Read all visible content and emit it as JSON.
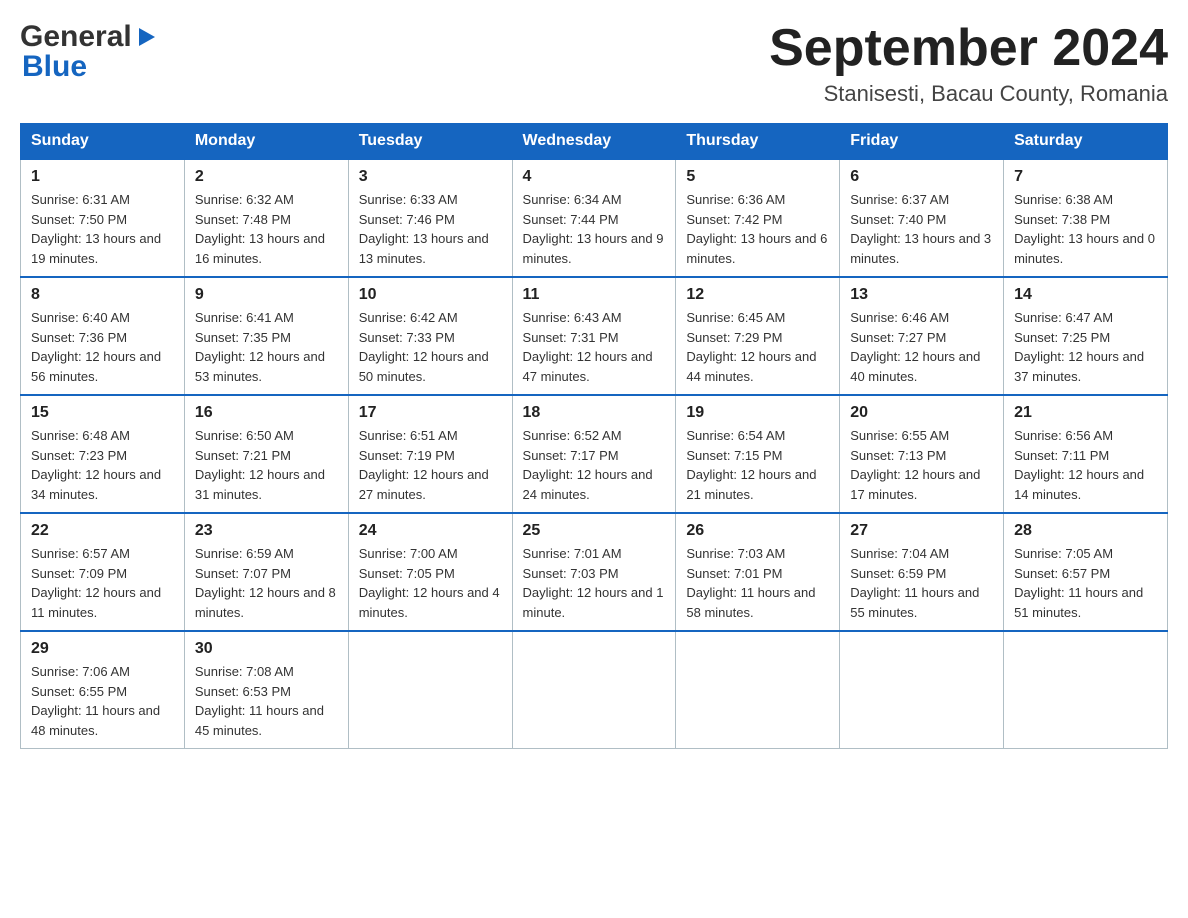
{
  "header": {
    "logo": {
      "general": "General",
      "blue": "Blue",
      "arrow": "▶"
    },
    "title": "September 2024",
    "location": "Stanisesti, Bacau County, Romania"
  },
  "calendar": {
    "days_of_week": [
      "Sunday",
      "Monday",
      "Tuesday",
      "Wednesday",
      "Thursday",
      "Friday",
      "Saturday"
    ],
    "weeks": [
      [
        {
          "day": "1",
          "sunrise": "6:31 AM",
          "sunset": "7:50 PM",
          "daylight": "13 hours and 19 minutes."
        },
        {
          "day": "2",
          "sunrise": "6:32 AM",
          "sunset": "7:48 PM",
          "daylight": "13 hours and 16 minutes."
        },
        {
          "day": "3",
          "sunrise": "6:33 AM",
          "sunset": "7:46 PM",
          "daylight": "13 hours and 13 minutes."
        },
        {
          "day": "4",
          "sunrise": "6:34 AM",
          "sunset": "7:44 PM",
          "daylight": "13 hours and 9 minutes."
        },
        {
          "day": "5",
          "sunrise": "6:36 AM",
          "sunset": "7:42 PM",
          "daylight": "13 hours and 6 minutes."
        },
        {
          "day": "6",
          "sunrise": "6:37 AM",
          "sunset": "7:40 PM",
          "daylight": "13 hours and 3 minutes."
        },
        {
          "day": "7",
          "sunrise": "6:38 AM",
          "sunset": "7:38 PM",
          "daylight": "13 hours and 0 minutes."
        }
      ],
      [
        {
          "day": "8",
          "sunrise": "6:40 AM",
          "sunset": "7:36 PM",
          "daylight": "12 hours and 56 minutes."
        },
        {
          "day": "9",
          "sunrise": "6:41 AM",
          "sunset": "7:35 PM",
          "daylight": "12 hours and 53 minutes."
        },
        {
          "day": "10",
          "sunrise": "6:42 AM",
          "sunset": "7:33 PM",
          "daylight": "12 hours and 50 minutes."
        },
        {
          "day": "11",
          "sunrise": "6:43 AM",
          "sunset": "7:31 PM",
          "daylight": "12 hours and 47 minutes."
        },
        {
          "day": "12",
          "sunrise": "6:45 AM",
          "sunset": "7:29 PM",
          "daylight": "12 hours and 44 minutes."
        },
        {
          "day": "13",
          "sunrise": "6:46 AM",
          "sunset": "7:27 PM",
          "daylight": "12 hours and 40 minutes."
        },
        {
          "day": "14",
          "sunrise": "6:47 AM",
          "sunset": "7:25 PM",
          "daylight": "12 hours and 37 minutes."
        }
      ],
      [
        {
          "day": "15",
          "sunrise": "6:48 AM",
          "sunset": "7:23 PM",
          "daylight": "12 hours and 34 minutes."
        },
        {
          "day": "16",
          "sunrise": "6:50 AM",
          "sunset": "7:21 PM",
          "daylight": "12 hours and 31 minutes."
        },
        {
          "day": "17",
          "sunrise": "6:51 AM",
          "sunset": "7:19 PM",
          "daylight": "12 hours and 27 minutes."
        },
        {
          "day": "18",
          "sunrise": "6:52 AM",
          "sunset": "7:17 PM",
          "daylight": "12 hours and 24 minutes."
        },
        {
          "day": "19",
          "sunrise": "6:54 AM",
          "sunset": "7:15 PM",
          "daylight": "12 hours and 21 minutes."
        },
        {
          "day": "20",
          "sunrise": "6:55 AM",
          "sunset": "7:13 PM",
          "daylight": "12 hours and 17 minutes."
        },
        {
          "day": "21",
          "sunrise": "6:56 AM",
          "sunset": "7:11 PM",
          "daylight": "12 hours and 14 minutes."
        }
      ],
      [
        {
          "day": "22",
          "sunrise": "6:57 AM",
          "sunset": "7:09 PM",
          "daylight": "12 hours and 11 minutes."
        },
        {
          "day": "23",
          "sunrise": "6:59 AM",
          "sunset": "7:07 PM",
          "daylight": "12 hours and 8 minutes."
        },
        {
          "day": "24",
          "sunrise": "7:00 AM",
          "sunset": "7:05 PM",
          "daylight": "12 hours and 4 minutes."
        },
        {
          "day": "25",
          "sunrise": "7:01 AM",
          "sunset": "7:03 PM",
          "daylight": "12 hours and 1 minute."
        },
        {
          "day": "26",
          "sunrise": "7:03 AM",
          "sunset": "7:01 PM",
          "daylight": "11 hours and 58 minutes."
        },
        {
          "day": "27",
          "sunrise": "7:04 AM",
          "sunset": "6:59 PM",
          "daylight": "11 hours and 55 minutes."
        },
        {
          "day": "28",
          "sunrise": "7:05 AM",
          "sunset": "6:57 PM",
          "daylight": "11 hours and 51 minutes."
        }
      ],
      [
        {
          "day": "29",
          "sunrise": "7:06 AM",
          "sunset": "6:55 PM",
          "daylight": "11 hours and 48 minutes."
        },
        {
          "day": "30",
          "sunrise": "7:08 AM",
          "sunset": "6:53 PM",
          "daylight": "11 hours and 45 minutes."
        },
        null,
        null,
        null,
        null,
        null
      ]
    ]
  },
  "labels": {
    "sunrise": "Sunrise:",
    "sunset": "Sunset:",
    "daylight": "Daylight:"
  }
}
